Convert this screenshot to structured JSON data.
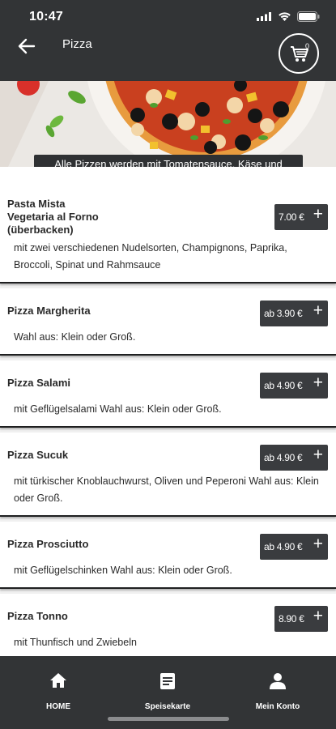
{
  "status": {
    "time": "10:47"
  },
  "header": {
    "title": "Pizza",
    "cart_count": "0"
  },
  "notice": "Alle Pizzen werden mit Tomatensauce, Käse und Oregano zubereitet.",
  "items": [
    {
      "name": "Pasta Mista\nVegetaria al Forno\n(überbacken)",
      "price": "7.00 €",
      "desc": "mit zwei verschiedenen Nudelsorten, Champignons, Paprika, Broccoli, Spinat und Rahmsauce"
    },
    {
      "name": "Pizza Margherita",
      "price": "ab 3.90 €",
      "desc": "Wahl aus: Klein oder Groß."
    },
    {
      "name": "Pizza Salami",
      "price": "ab 4.90 €",
      "desc": "mit Geflügelsalami Wahl aus: Klein oder Groß."
    },
    {
      "name": "Pizza Sucuk",
      "price": "ab 4.90 €",
      "desc": "mit türkischer Knoblauchwurst, Oliven und Peperoni Wahl aus: Klein oder Groß."
    },
    {
      "name": "Pizza Prosciutto",
      "price": "ab 4.90 €",
      "desc": "mit Geflügelschinken Wahl aus: Klein oder Groß."
    },
    {
      "name": "Pizza Tonno",
      "price": "8.90 €",
      "desc": "mit Thunfisch und Zwiebeln"
    }
  ],
  "nav": {
    "home": "HOME",
    "menu": "Speisekarte",
    "account": "Mein Konto"
  }
}
